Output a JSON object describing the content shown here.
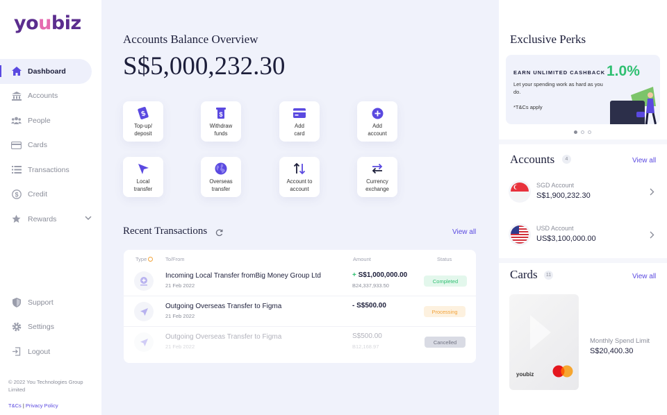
{
  "brand": {
    "logo_a": "yo",
    "logo_b": "u",
    "logo_c": "biz",
    "accent": "#5a49e0",
    "green": "#2fbf71"
  },
  "sidebar": {
    "items": [
      {
        "label": "Dashboard",
        "icon": "home-icon",
        "active": true
      },
      {
        "label": "Accounts",
        "icon": "bank-icon"
      },
      {
        "label": "People",
        "icon": "people-icon"
      },
      {
        "label": "Cards",
        "icon": "card-icon"
      },
      {
        "label": "Transactions",
        "icon": "list-icon"
      },
      {
        "label": "Credit",
        "icon": "dollar-icon"
      },
      {
        "label": "Rewards",
        "icon": "star-icon"
      }
    ],
    "bottom": [
      {
        "label": "Support",
        "icon": "shield-icon"
      },
      {
        "label": "Settings",
        "icon": "gear-icon"
      },
      {
        "label": "Logout",
        "icon": "logout-icon"
      }
    ],
    "copyright": "© 2022 You Technologies Group Limited",
    "tcs": "T&Cs",
    "separator": "|",
    "privacy": "Privacy Policy"
  },
  "overview": {
    "title": "Accounts Balance Overview",
    "balance": "S$5,000,232.30"
  },
  "quick_actions": [
    {
      "label": "Top-up/\ndeposit",
      "icon": "topup-icon"
    },
    {
      "label": "Withdraw\nfunds",
      "icon": "withdraw-icon"
    },
    {
      "label": "Add\ncard",
      "icon": "add-card-icon"
    },
    {
      "label": "Add\naccount",
      "icon": "add-account-icon"
    },
    {
      "label": "Local\ntransfer",
      "icon": "local-transfer-icon"
    },
    {
      "label": "Overseas\ntransfer",
      "icon": "globe-icon"
    },
    {
      "label": "Account to\naccount",
      "icon": "swap-vertical-icon"
    },
    {
      "label": "Currency\nexchange",
      "icon": "exchange-icon"
    }
  ],
  "recent": {
    "title": "Recent Transactions",
    "view_all": "View all",
    "columns": {
      "type": "Type",
      "to_from": "To/From",
      "amount": "Amount",
      "status": "Status"
    },
    "rows": [
      {
        "name": "Incoming Local Transfer fromBig Money Group Ltd",
        "date": "21 Feb 2022",
        "sign": "+",
        "amount": "S$1,000,000.00",
        "sub": "B24,337,933.50",
        "status": "Completed",
        "status_bg": "#e3f7ec",
        "status_fg": "#2fbf71"
      },
      {
        "name": "Outgoing Overseas Transfer to Figma",
        "date": "21 Feb 2022",
        "sign": "",
        "amount": "- S$500.00",
        "sub": "",
        "status": "Processing",
        "status_bg": "#fdf1df",
        "status_fg": "#f2a33a"
      },
      {
        "name": "Outgoing Overseas Transfer to Figma",
        "date": "21 Feb 2022",
        "sign": "",
        "amount": "S$500.00",
        "sub": "B12,168.97",
        "status": "Cancelled",
        "status_bg": "#d9dbe4",
        "status_fg": "#6f7280"
      }
    ]
  },
  "perks": {
    "title": "Exclusive Perks",
    "headline": "EARN UNLIMITED CASHBACK",
    "percent": "1.0%",
    "desc": "Let your spending work as hard as you do.",
    "tc": "*T&Cs apply"
  },
  "accounts": {
    "title": "Accounts",
    "count": "4",
    "view_all": "View all",
    "items": [
      {
        "name": "SGD Account",
        "value": "S$1,900,232.30",
        "flag": "sg-flag-icon"
      },
      {
        "name": "USD Account",
        "value": "US$3,100,000.00",
        "flag": "us-flag-icon"
      }
    ]
  },
  "cards": {
    "title": "Cards",
    "count": "11",
    "view_all": "View all",
    "card_brand": "youbiz",
    "limit_label": "Monthly Spend Limit",
    "limit_value": "S$20,400.30"
  }
}
